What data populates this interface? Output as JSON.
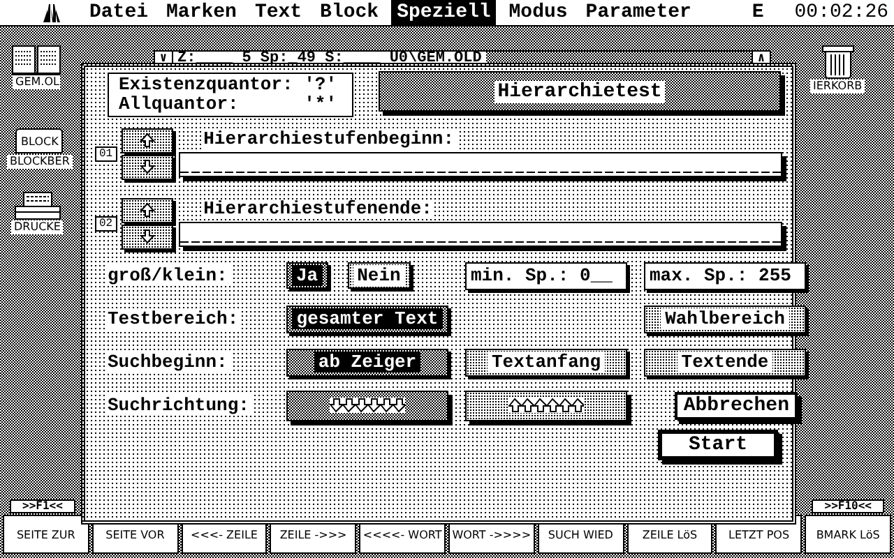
{
  "menu_bar": {
    "items": [
      {
        "label": "Datei",
        "selected": false
      },
      {
        "label": "Marken",
        "selected": false
      },
      {
        "label": "Text",
        "selected": false
      },
      {
        "label": "Block",
        "selected": false
      },
      {
        "label": "Speziell",
        "selected": true
      },
      {
        "label": "Modus",
        "selected": false
      },
      {
        "label": "Parameter",
        "selected": false
      }
    ],
    "mode": "E",
    "clock": "00:02:26"
  },
  "desktop_icons": [
    {
      "kind": "book",
      "label": "GEM.OL"
    },
    {
      "kind": "block",
      "icon_text": "BLOCK",
      "label": "BLOCKBER"
    },
    {
      "kind": "printer",
      "label": "DRUCKE"
    },
    {
      "kind": "trash",
      "label": "IERKORB"
    }
  ],
  "window": {
    "left_button": "∨",
    "info": "Z:____ 5 Sp:_49 S:____ U0\\GEM.OLD",
    "right_button": "∧"
  },
  "dialog": {
    "quantors": [
      "Existenzquantor: '?'",
      "Allquantor:      '*'"
    ],
    "title": "Hierarchietest",
    "levels": [
      {
        "badge": "01",
        "label": "Hierarchiestufenbeginn:"
      },
      {
        "badge": "02",
        "label": "Hierarchiestufenende:"
      }
    ],
    "rows": [
      {
        "label": "groß/klein:",
        "kind": "case",
        "options": [
          {
            "label": "Ja",
            "selected": true
          },
          {
            "label": "Nein",
            "selected": false
          }
        ],
        "fields": [
          "min. Sp.: 0__",
          "max. Sp.: 255"
        ]
      },
      {
        "label": "Testbereich:",
        "kind": "choice",
        "options": [
          {
            "label": "gesamter Text",
            "selected": true
          },
          {
            "label": "Wahlbereich",
            "selected": false
          }
        ]
      },
      {
        "label": "Suchbeginn:",
        "kind": "choice",
        "options": [
          {
            "label": "ab Zeiger",
            "selected": true
          },
          {
            "label": "Textanfang",
            "selected": false
          },
          {
            "label": "Textende",
            "selected": false
          }
        ]
      },
      {
        "label": "Suchrichtung:",
        "kind": "direction",
        "options": [
          {
            "kind": "down",
            "selected": true
          },
          {
            "kind": "up",
            "selected": false
          }
        ],
        "button": "Abbrechen"
      }
    ],
    "default_button": "Start"
  },
  "function_keys": {
    "first": ">>F1<<",
    "last": ">>F10<<",
    "keys": [
      "SEITE ZUR",
      "SEITE VOR",
      "<<<- ZEILE",
      "ZEILE ->>>",
      "<<<<- WORT",
      "WORT ->>>>",
      "SUCH WIED",
      "ZEILE LöS",
      "LETZT POS",
      "BMARK LöS"
    ]
  }
}
